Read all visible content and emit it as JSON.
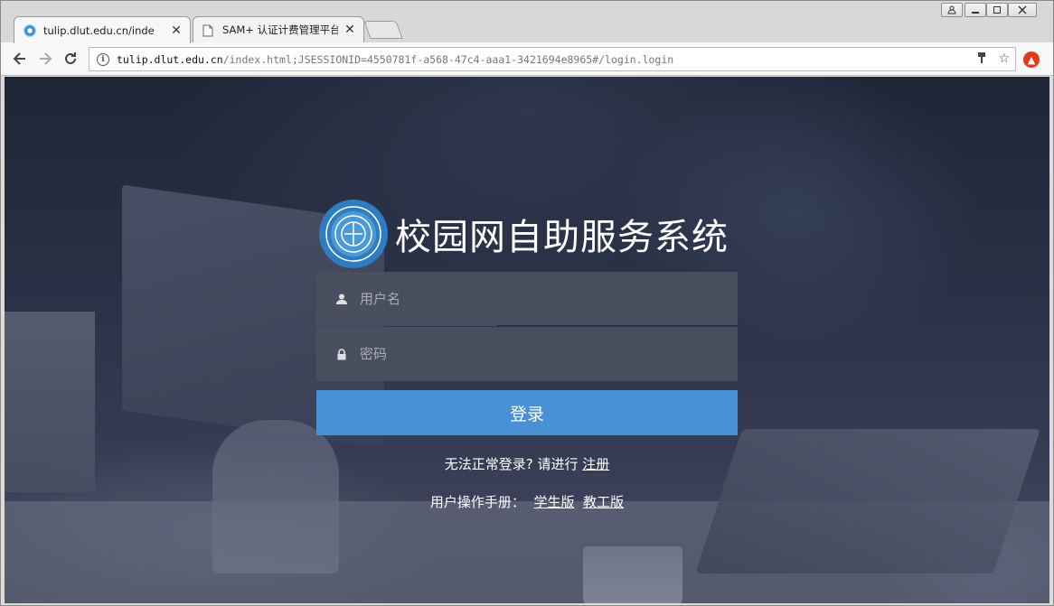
{
  "browser": {
    "tabs": [
      {
        "title": "tulip.dlut.edu.cn/inde",
        "close": "✕"
      },
      {
        "title": "SAM+ 认证计费管理平台",
        "close": "✕"
      }
    ],
    "url_host": "tulip.dlut.edu.cn",
    "url_rest": "/index.html;JSESSIONID=4550781f-a568-47c4-aaa1-3421694e8965#/login.login",
    "back_icon": "arrow-left-icon",
    "forward_icon": "arrow-right-icon",
    "reload_icon": "reload-icon"
  },
  "login": {
    "system_title": "校园网自助服务系统",
    "username_placeholder": "用户名",
    "password_placeholder": "密码",
    "login_label": "登录",
    "trouble_text": "无法正常登录? 请进行",
    "register_link": "注册",
    "manual_text": "用户操作手册：",
    "student_link": "学生版",
    "staff_link": "教工版"
  },
  "colors": {
    "accent": "#4a90d4",
    "field_bg": "#4a5060",
    "ext_badge": "#e03a1e"
  }
}
